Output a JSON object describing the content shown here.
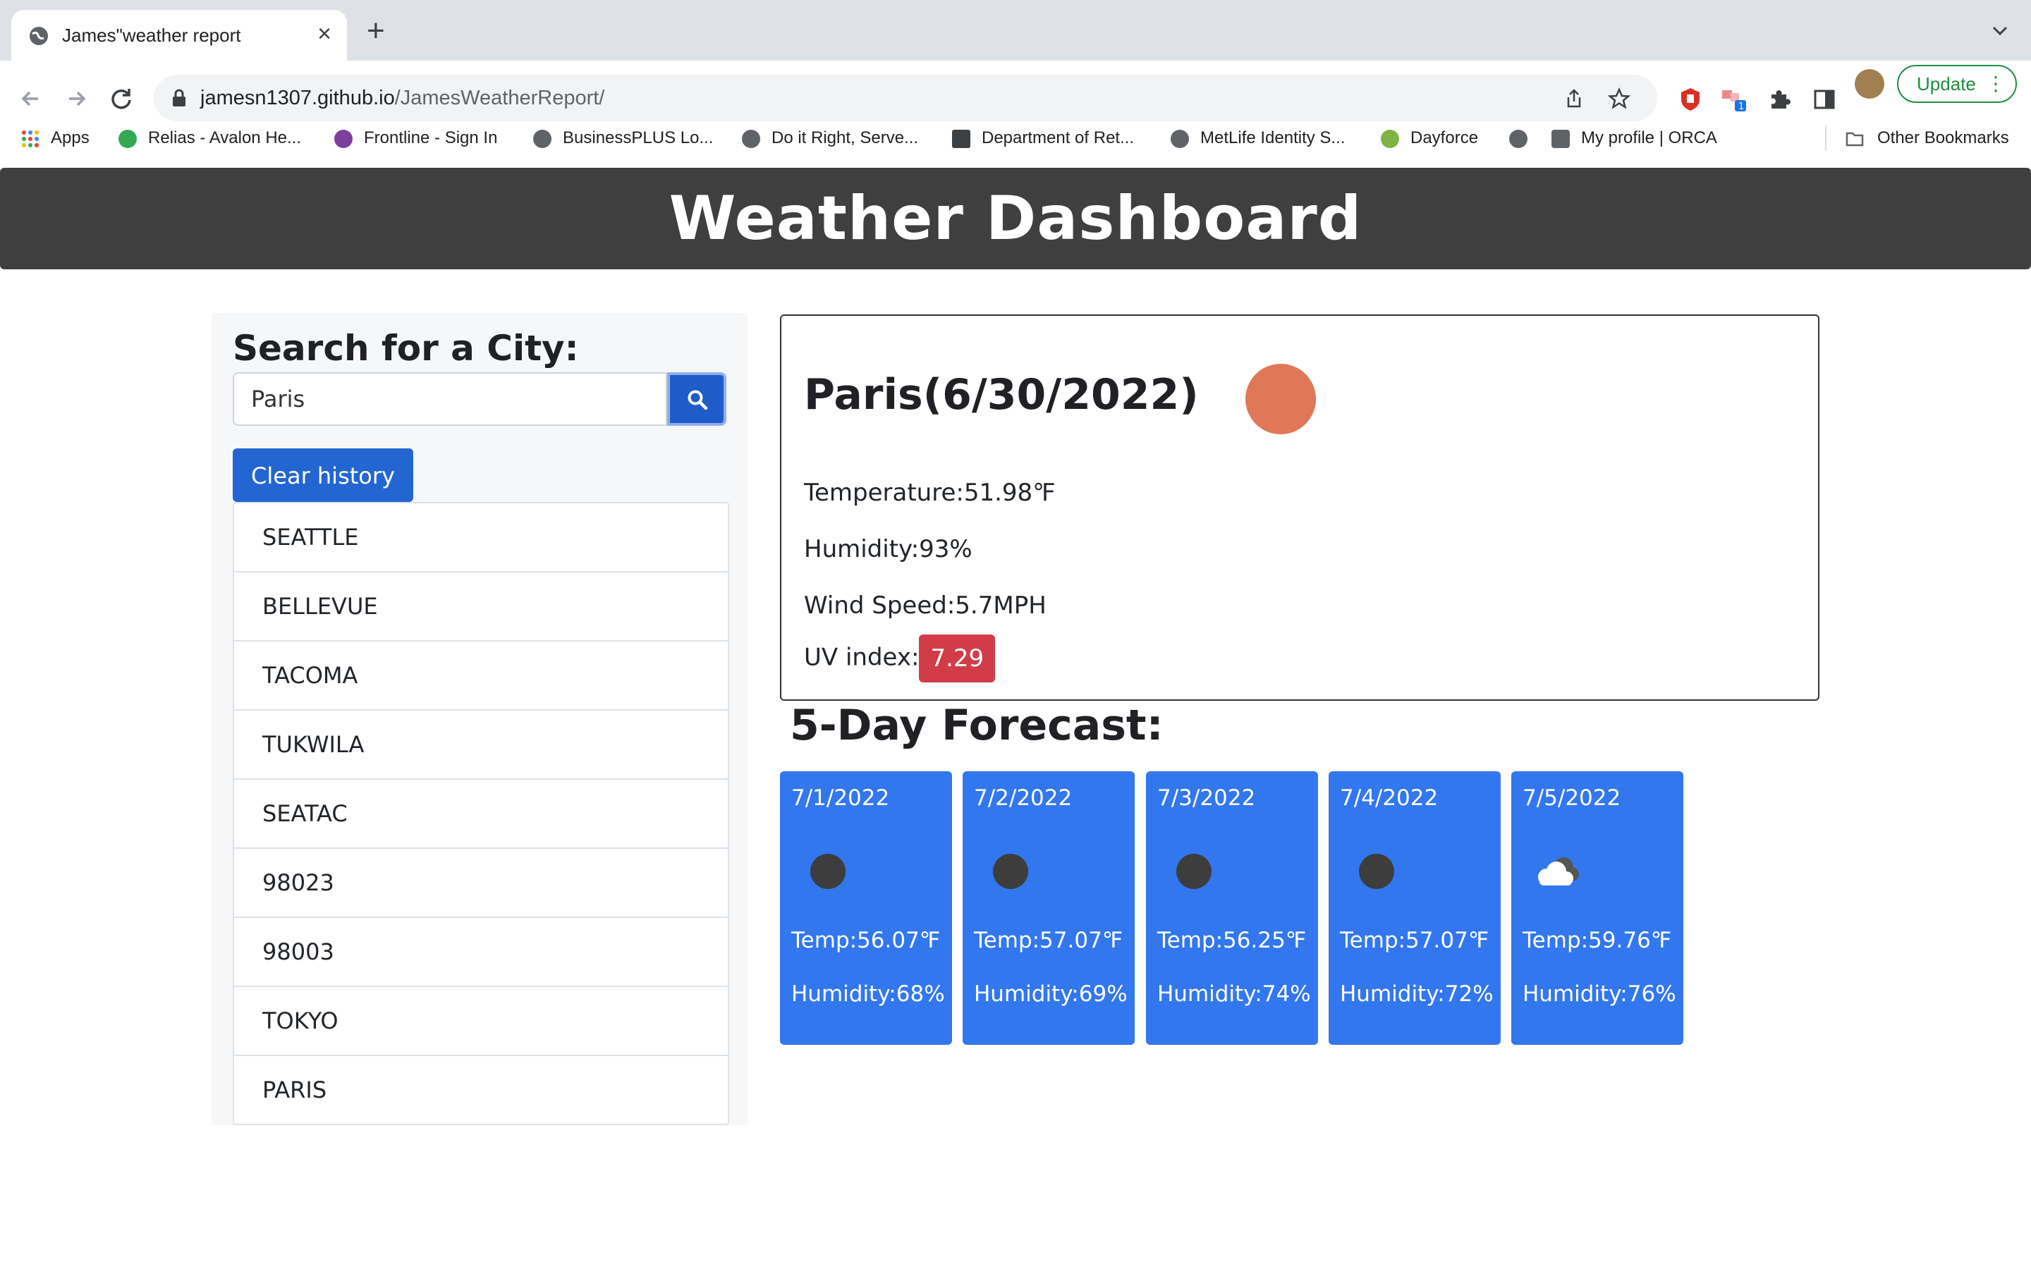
{
  "browser": {
    "tab_title": "James\"weather report",
    "url_host": "jamesn1307.github.io",
    "url_path": "/JamesWeatherReport/",
    "update_label": "Update",
    "bookmarks": [
      {
        "label": "Apps",
        "icon": "apps-grid-icon"
      },
      {
        "label": "Relias - Avalon He...",
        "icon": "relias-icon"
      },
      {
        "label": "Frontline - Sign In",
        "icon": "frontline-icon"
      },
      {
        "label": "BusinessPLUS Lo...",
        "icon": "globe-icon"
      },
      {
        "label": "Do it Right, Serve...",
        "icon": "globe-icon"
      },
      {
        "label": "Department of Ret...",
        "icon": "drs-icon"
      },
      {
        "label": "MetLife Identity S...",
        "icon": "globe-icon"
      },
      {
        "label": "Dayforce",
        "icon": "dayforce-icon"
      },
      {
        "label": "",
        "icon": "globe-icon"
      },
      {
        "label": "My profile | ORCA",
        "icon": "orca-icon"
      },
      {
        "label": "Other Bookmarks",
        "icon": "folder-icon"
      }
    ]
  },
  "page": {
    "title": "Weather Dashboard",
    "search": {
      "heading": "Search for a City:",
      "value": "Paris",
      "clear_label": "Clear history"
    },
    "history": [
      "SEATTLE",
      "BELLEVUE",
      "TACOMA",
      "TUKWILA",
      "SEATAC",
      "98023",
      "98003",
      "TOKYO",
      "PARIS"
    ],
    "current": {
      "city_date": "Paris(6/30/2022)",
      "temperature": "Temperature:51.98℉",
      "humidity": "Humidity:93%",
      "wind": "Wind Speed:5.7MPH",
      "uv_label": "UV index:",
      "uv_value": "7.29",
      "uv_color": "#d13c48",
      "icon": "sun-icon"
    },
    "forecast_title": "5-Day Forecast:",
    "forecast": [
      {
        "date": "7/1/2022",
        "temp": "Temp:56.07℉",
        "humidity": "Humidity:68%",
        "icon": "dark-circle-icon"
      },
      {
        "date": "7/2/2022",
        "temp": "Temp:57.07℉",
        "humidity": "Humidity:69%",
        "icon": "dark-circle-icon"
      },
      {
        "date": "7/3/2022",
        "temp": "Temp:56.25℉",
        "humidity": "Humidity:74%",
        "icon": "dark-circle-icon"
      },
      {
        "date": "7/4/2022",
        "temp": "Temp:57.07℉",
        "humidity": "Humidity:72%",
        "icon": "dark-circle-icon"
      },
      {
        "date": "7/5/2022",
        "temp": "Temp:59.76℉",
        "humidity": "Humidity:76%",
        "icon": "cloud-icon"
      }
    ],
    "colors": {
      "header_bg": "#3f3f3f",
      "card_bg": "#3377ee",
      "button_bg": "#2366d1"
    }
  }
}
